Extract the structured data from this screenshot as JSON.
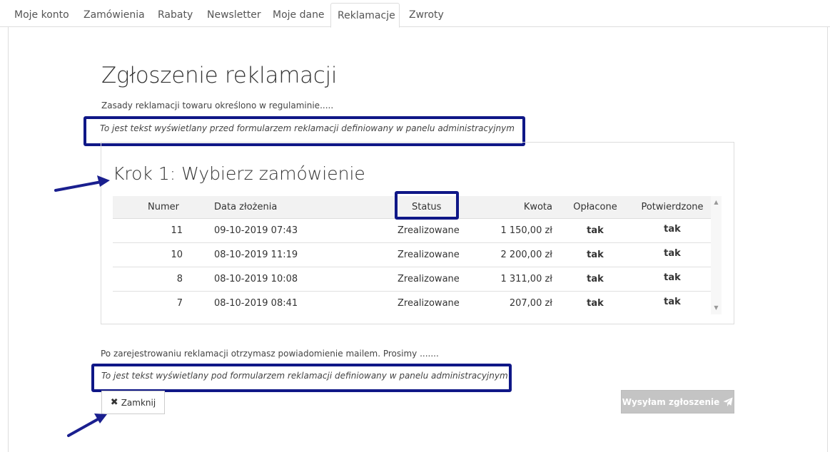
{
  "tabs": [
    {
      "label": "Moje konto"
    },
    {
      "label": "Zamówienia"
    },
    {
      "label": "Rabaty"
    },
    {
      "label": "Newsletter"
    },
    {
      "label": "Moje dane"
    },
    {
      "label": "Reklamacje",
      "active": true
    },
    {
      "label": "Zwroty"
    }
  ],
  "page": {
    "title": "Zgłoszenie reklamacji",
    "intro": "Zasady reklamacji towaru określono w regulaminie.....",
    "before_form_text": "To jest tekst wyświetlany przed formularzem reklamacji definiowany w panelu administracyjnym",
    "after_text": "Po zarejestrowaniu reklamacji otrzymasz powiadomienie mailem. Prosimy .......",
    "after_form_text": "To jest tekst wyświetlany pod formularzem reklamacji definiowany w panelu administracyjnym"
  },
  "step": {
    "title": "Krok 1: Wybierz zamówienie"
  },
  "table": {
    "headers": {
      "number": "Numer",
      "date": "Data złożenia",
      "status": "Status",
      "amount": "Kwota",
      "paid": "Opłacone",
      "confirmed": "Potwierdzone"
    },
    "rows": [
      {
        "number": "11",
        "date": "09-10-2019 07:43",
        "status": "Zrealizowane",
        "amount": "1 150,00 zł",
        "paid": "tak",
        "confirmed": "tak"
      },
      {
        "number": "10",
        "date": "08-10-2019 11:19",
        "status": "Zrealizowane",
        "amount": "2 200,00 zł",
        "paid": "tak",
        "confirmed": "tak"
      },
      {
        "number": "8",
        "date": "08-10-2019 10:08",
        "status": "Zrealizowane",
        "amount": "1 311,00 zł",
        "paid": "tak",
        "confirmed": "tak"
      },
      {
        "number": "7",
        "date": "08-10-2019 08:41",
        "status": "Zrealizowane",
        "amount": "207,00 zł",
        "paid": "tak",
        "confirmed": "tak"
      }
    ]
  },
  "buttons": {
    "close_label": "Zamknij",
    "send_label": "Wysyłam zgłoszenie"
  },
  "colors": {
    "highlight": "#0f1787",
    "arrow": "#1a1f8f",
    "disabled_button": "#c4c4c4"
  },
  "icons": {
    "close": "times-icon",
    "send": "paper-plane-icon"
  }
}
